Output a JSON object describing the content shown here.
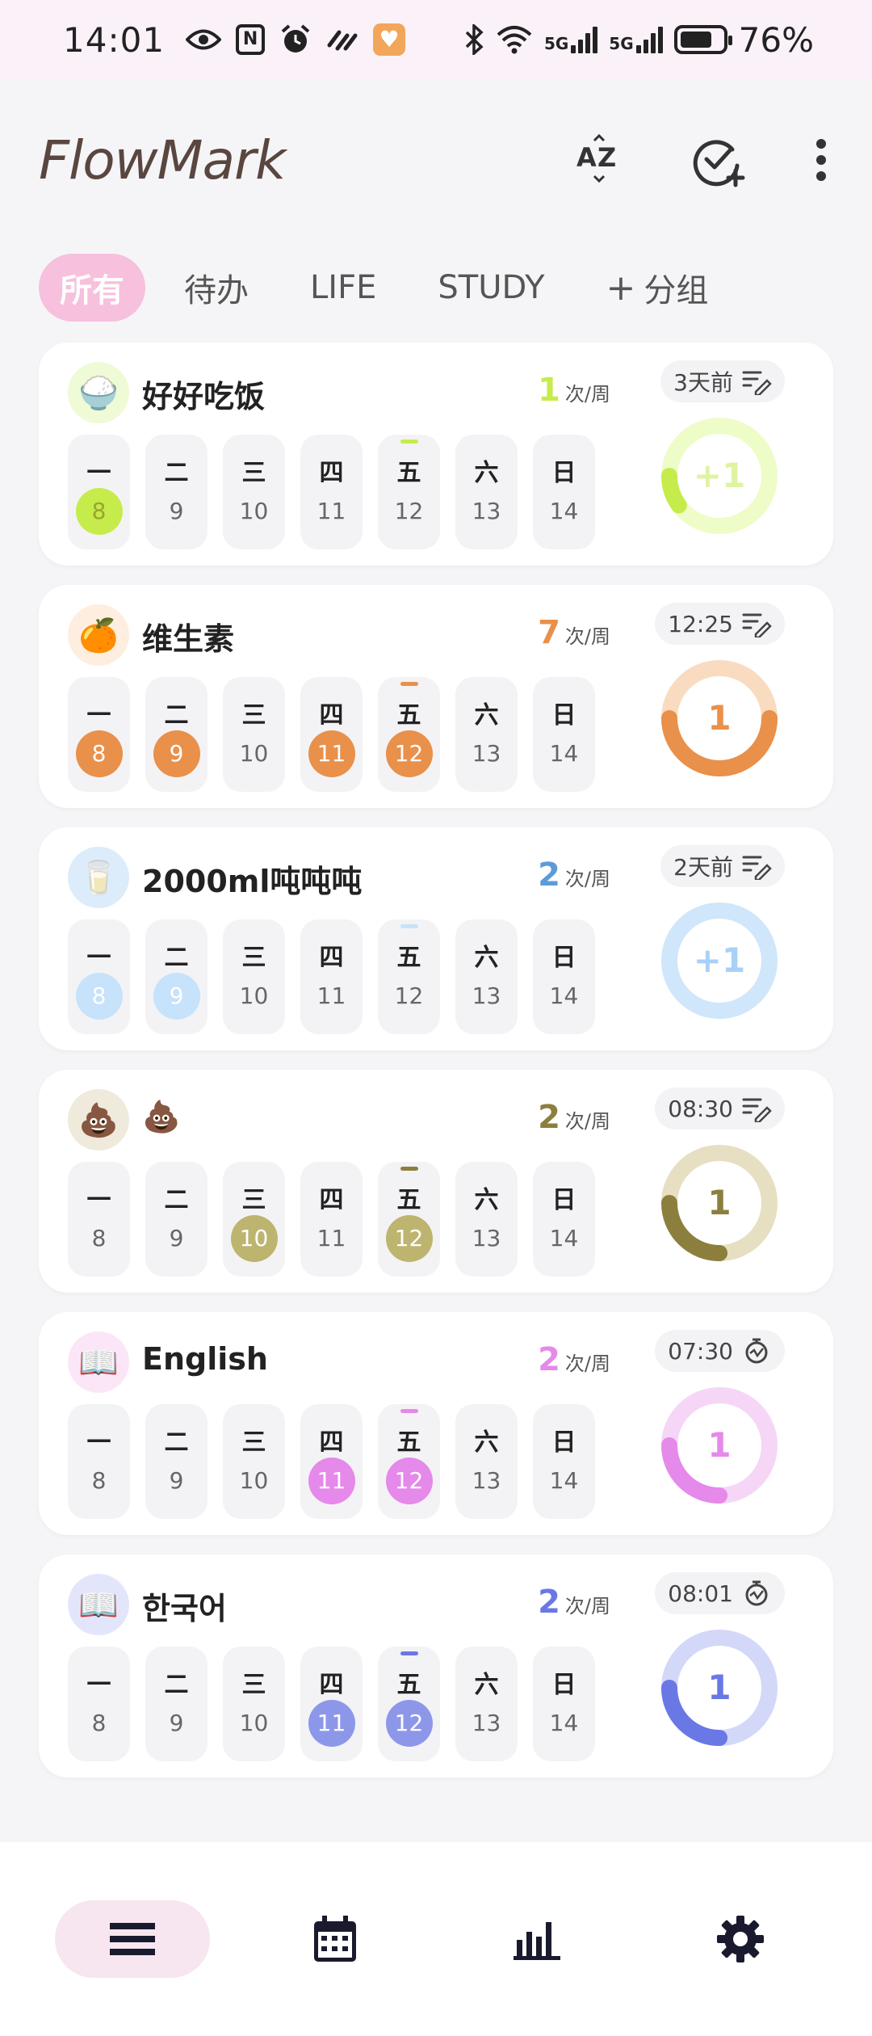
{
  "status_bar": {
    "time": "14:01",
    "five_g_1": "5G",
    "five_g_2": "5G",
    "battery": "76%",
    "battery_level": 0.76,
    "icons": [
      "eye-icon",
      "nfc-icon",
      "alarm-icon",
      "link-icon",
      "heart-app-icon",
      "bluetooth-icon",
      "wifi-icon",
      "signal-icon",
      "signal-icon",
      "battery-icon"
    ]
  },
  "header": {
    "app_title": "FlowMark",
    "actions": [
      "sort-az-icon",
      "add-check-icon",
      "more-vertical-icon"
    ]
  },
  "tabs": {
    "all": "所有",
    "todo": "待办",
    "life": "LIFE",
    "study": "STUDY",
    "add_group": "分组",
    "add_glyph": "+"
  },
  "weekdays": [
    "一",
    "二",
    "三",
    "四",
    "五",
    "六",
    "日"
  ],
  "dates": [
    "8",
    "9",
    "10",
    "11",
    "12",
    "13",
    "14"
  ],
  "freq_unit": "次/周",
  "habits": [
    {
      "name": "好好吃饭",
      "icon": "🍚",
      "icon_bg": "#eefbd6",
      "color": "#c6ec4c",
      "light": "#eefcc8",
      "freq": "1",
      "tag": "3天前",
      "tag_icon": "note-edit-icon",
      "done_days": [
        0
      ],
      "done_text_color": "#9aa52a",
      "ring_text": "+1",
      "progress": 0.1
    },
    {
      "name": "维生素",
      "icon": "🍊",
      "icon_bg": "#fdeedf",
      "color": "#e9904a",
      "light": "#f9dcc0",
      "freq": "7",
      "tag": "12:25",
      "tag_icon": "note-edit-icon",
      "done_days": [
        0,
        1,
        3,
        4
      ],
      "done_text_color": "#ffffff",
      "ring_text": "1",
      "progress": 0.5
    },
    {
      "name": "2000ml吨吨吨",
      "icon": "🥛",
      "icon_bg": "#dcecfb",
      "color": "#c7e2fb",
      "light": "#cfe6fb",
      "freq": "2",
      "freq_color": "#5d9bd8",
      "tag": "2天前",
      "tag_icon": "note-edit-icon",
      "done_days": [
        0,
        1
      ],
      "done_text_color": "#ffffff",
      "ring_text": "+1",
      "progress": 0
    },
    {
      "name": "💩",
      "icon": "💩",
      "icon_bg": "#efeadb",
      "color": "#8c7f3e",
      "light": "#e6dfc2",
      "freq": "2",
      "tag": "08:30",
      "tag_icon": "note-edit-icon",
      "done_days": [
        2,
        4
      ],
      "done_text_color": "#ffffff",
      "done_bg": "#bdb46f",
      "ring_text": "1",
      "progress": 0.25
    },
    {
      "name": "English",
      "icon": "📖",
      "icon_bg": "#fbe6f8",
      "color": "#e589ea",
      "light": "#f6d6f7",
      "freq": "2",
      "tag": "07:30",
      "tag_icon": "stopwatch-icon",
      "done_days": [
        3,
        4
      ],
      "done_text_color": "#ffffff",
      "ring_text": "1",
      "progress": 0.25
    },
    {
      "name": "한국어",
      "icon": "📖",
      "icon_bg": "#e3e6fb",
      "color": "#6a78e6",
      "light": "#d3d8f8",
      "freq": "2",
      "tag": "08:01",
      "tag_icon": "stopwatch-icon",
      "done_days": [
        3,
        4
      ],
      "done_text_color": "#ffffff",
      "done_bg": "#8d97ea",
      "ring_text": "1",
      "progress": 0.25
    }
  ],
  "today_index": 4,
  "bottom_nav": [
    "list-icon",
    "calendar-icon",
    "stats-icon",
    "settings-icon"
  ]
}
